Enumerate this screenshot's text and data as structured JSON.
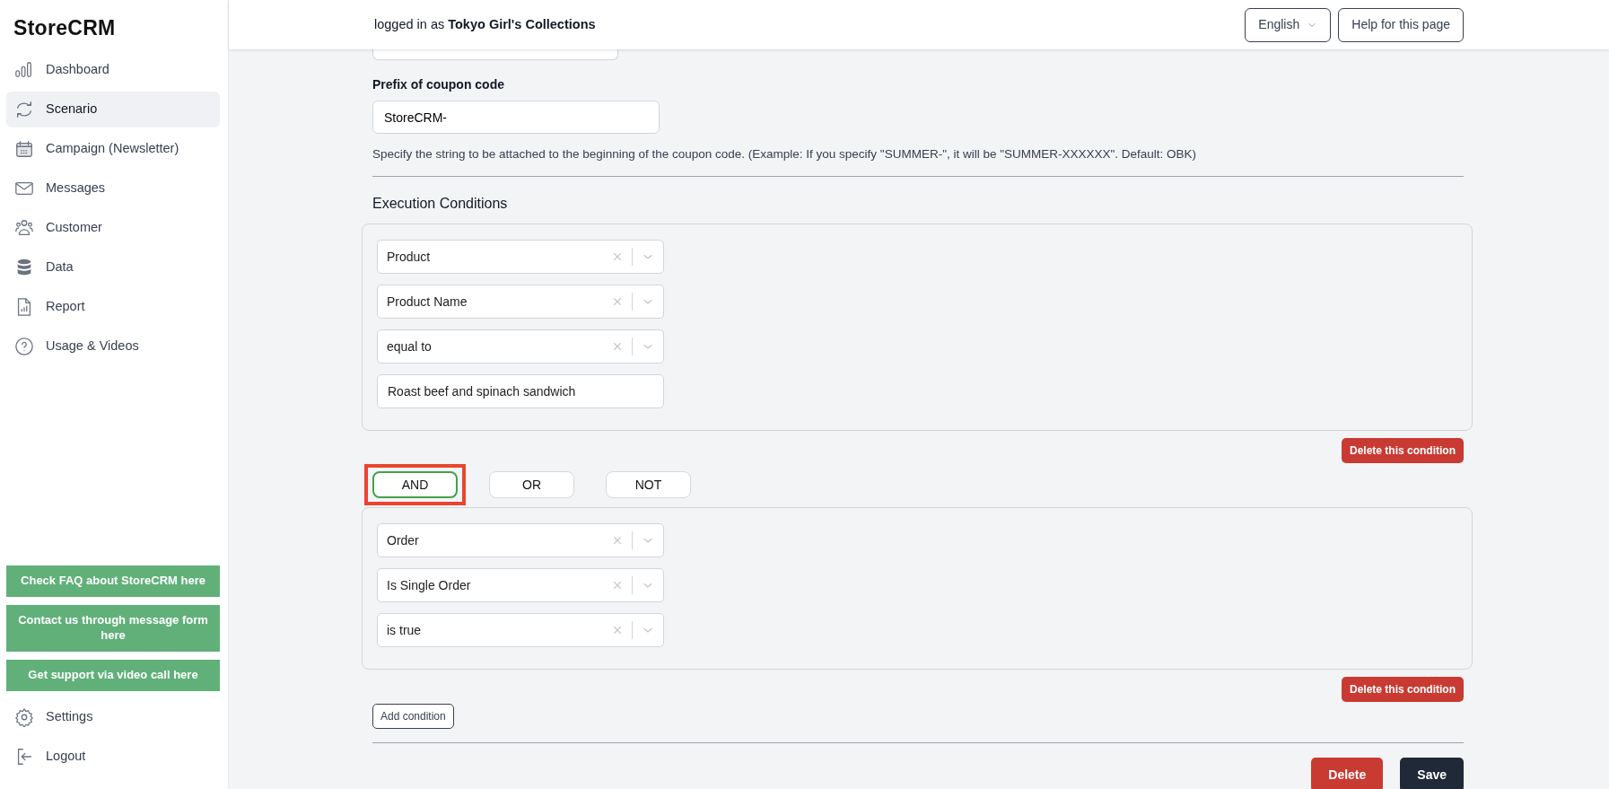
{
  "sidebar": {
    "logo": "StoreCRM",
    "items": [
      {
        "label": "Dashboard",
        "selected": false
      },
      {
        "label": "Scenario",
        "selected": true
      },
      {
        "label": "Campaign (Newsletter)",
        "selected": false
      },
      {
        "label": "Messages",
        "selected": false
      },
      {
        "label": "Customer",
        "selected": false
      },
      {
        "label": "Data",
        "selected": false
      },
      {
        "label": "Report",
        "selected": false
      },
      {
        "label": "Usage & Videos",
        "selected": false
      }
    ],
    "support_links": [
      "Check FAQ about StoreCRM here",
      "Contact us through message form here",
      "Get support via video call here"
    ],
    "footer_items": [
      {
        "label": "Settings"
      },
      {
        "label": "Logout"
      }
    ]
  },
  "header": {
    "user_prefix": "logged in as",
    "user_name": "Tokyo Girl's Collections",
    "language": "English",
    "help_button": "Help for this page"
  },
  "form": {
    "prefix_label": "Prefix of coupon code",
    "prefix_value": "StoreCRM-",
    "prefix_help": "Specify the string to be attached to the beginning of the coupon code. (Example: If you specify \"SUMMER-\", it will be \"SUMMER-XXXXXX\". Default: OBK)",
    "section_title": "Execution Conditions",
    "blocks": [
      {
        "kind": "condition",
        "fields": [
          {
            "kind": "select",
            "value": "Product"
          },
          {
            "kind": "select",
            "value": "Product Name"
          },
          {
            "kind": "select",
            "value": "equal to"
          },
          {
            "kind": "text",
            "value": "Roast beef and spinach sandwich"
          }
        ],
        "delete_button": "Delete this condition"
      },
      {
        "kind": "connector",
        "options": [
          {
            "label": "AND",
            "selected": true,
            "highlighted": true
          },
          {
            "label": "OR",
            "selected": false,
            "highlighted": false
          },
          {
            "label": "NOT",
            "selected": false,
            "highlighted": false
          }
        ]
      },
      {
        "kind": "condition",
        "fields": [
          {
            "kind": "select",
            "value": "Order"
          },
          {
            "kind": "select",
            "value": "Is Single Order"
          },
          {
            "kind": "select",
            "value": "is true"
          }
        ],
        "delete_button": "Delete this condition"
      }
    ],
    "add_condition": "Add condition",
    "actions": [
      {
        "kind": "danger",
        "label": "Delete"
      },
      {
        "kind": "primary",
        "label": "Save"
      }
    ]
  }
}
